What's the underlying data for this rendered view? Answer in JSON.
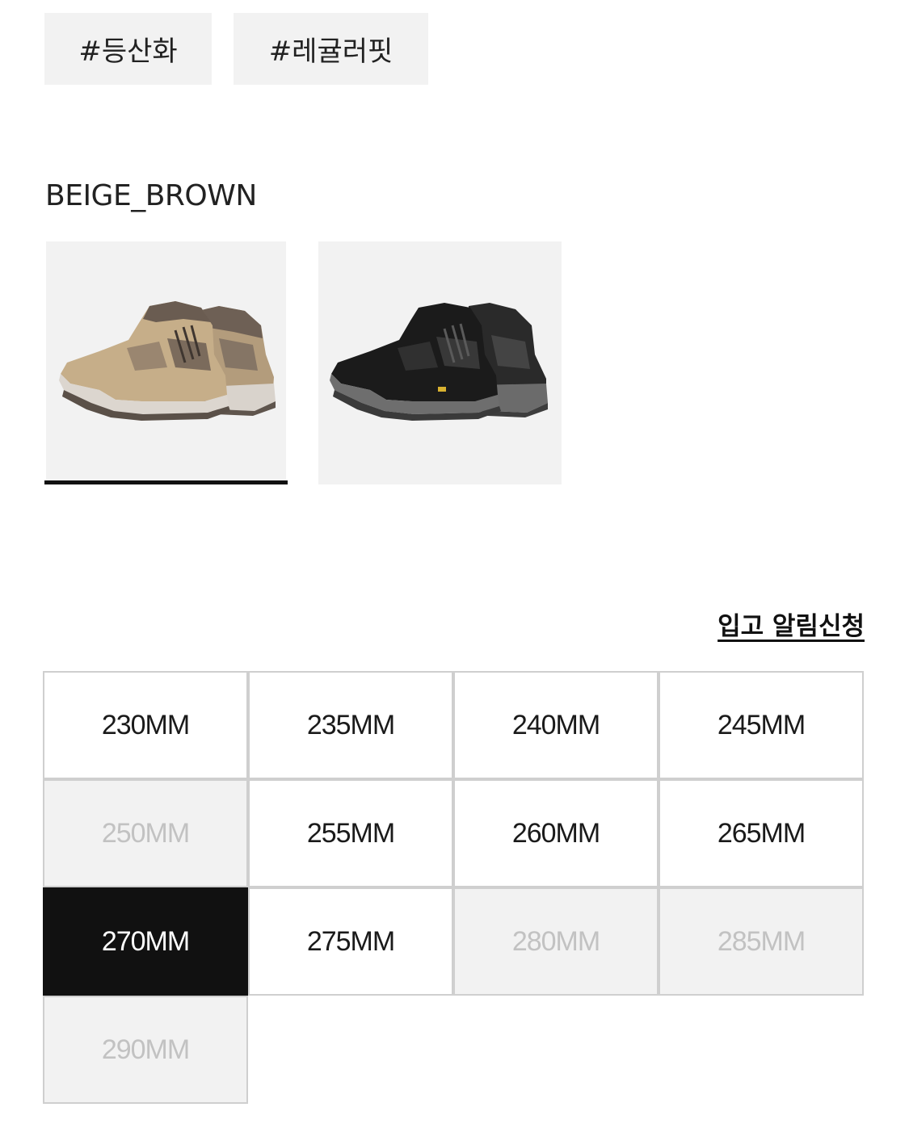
{
  "tags": [
    "#등산화",
    "#레귤러핏"
  ],
  "selected_color": "BEIGE_BROWN",
  "swatches": [
    {
      "name": "beige-brown",
      "selected": true
    },
    {
      "name": "black",
      "selected": false
    }
  ],
  "notify_label": "입고 알림신청",
  "sizes": [
    {
      "label": "230MM",
      "state": "available"
    },
    {
      "label": "235MM",
      "state": "available"
    },
    {
      "label": "240MM",
      "state": "available"
    },
    {
      "label": "245MM",
      "state": "available"
    },
    {
      "label": "250MM",
      "state": "soldout"
    },
    {
      "label": "255MM",
      "state": "available"
    },
    {
      "label": "260MM",
      "state": "available"
    },
    {
      "label": "265MM",
      "state": "available"
    },
    {
      "label": "270MM",
      "state": "selected"
    },
    {
      "label": "275MM",
      "state": "available"
    },
    {
      "label": "280MM",
      "state": "soldout"
    },
    {
      "label": "285MM",
      "state": "soldout"
    },
    {
      "label": "290MM",
      "state": "soldout"
    }
  ],
  "colors": {
    "selected_bg": "#111111",
    "soldout_bg": "#f2f2f2",
    "soldout_text": "#c2c2c2",
    "tag_bg": "#f2f2f2"
  }
}
